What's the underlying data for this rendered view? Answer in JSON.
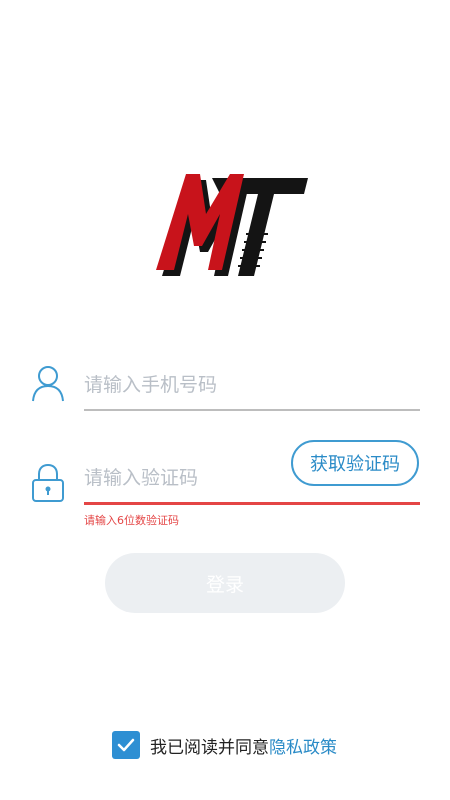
{
  "logo": {
    "text": "MT",
    "colors": {
      "red": "#c8131b",
      "black": "#141414"
    }
  },
  "phone": {
    "placeholder": "请输入手机号码",
    "value": ""
  },
  "code": {
    "placeholder": "请输入验证码",
    "value": "",
    "get_code_label": "获取验证码",
    "error": "请输入6位数验证码"
  },
  "login": {
    "label": "登录"
  },
  "agreement": {
    "checked": true,
    "text": "我已阅读并同意",
    "link": "隐私政策"
  },
  "colors": {
    "accent": "#2a8bc7",
    "error": "#e44545",
    "disabled_button": "#eceff2"
  }
}
